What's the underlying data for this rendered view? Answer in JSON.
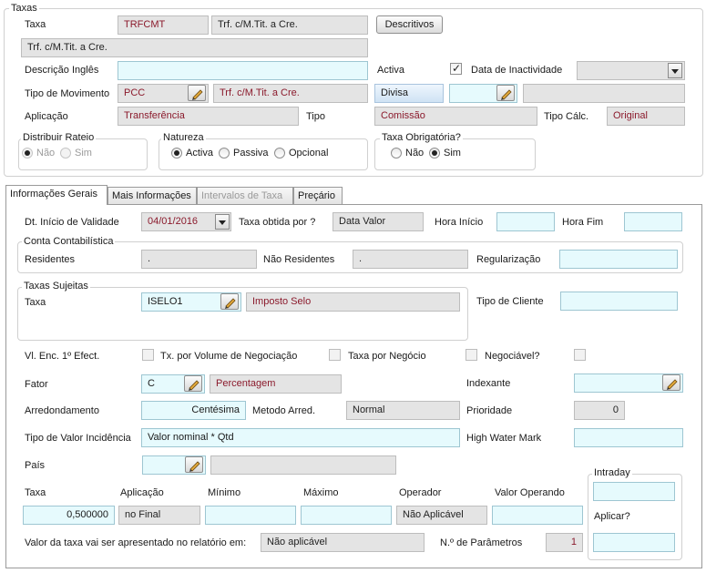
{
  "taxas": {
    "title": "Taxas",
    "taxa_label": "Taxa",
    "taxa_code": "TRFCMT",
    "taxa_desc": "Trf. c/M.Tit. a Cre.",
    "descritivos_btn": "Descritivos",
    "long_desc": "Trf. c/M.Tit. a Cre.",
    "desc_ingles_label": "Descrição Inglês",
    "desc_ingles_value": "",
    "activa_label": "Activa",
    "activa_checked": true,
    "data_inact_label": "Data de Inactividade",
    "data_inact_value": "",
    "tipo_mov_label": "Tipo de Movimento",
    "tipo_mov_code": "PCC",
    "tipo_mov_desc": "Trf. c/M.Tit. a Cre.",
    "divisa_label": "Divisa",
    "divisa_value": "",
    "divisa_desc": "",
    "aplicacao_label": "Aplicação",
    "aplicacao_value": "Transferência",
    "tipo_label": "Tipo",
    "tipo_value": "Comissão",
    "tipo_calc_label": "Tipo Cálc.",
    "tipo_calc_value": "Original",
    "distribuir_title": "Distribuir Rateio",
    "nao": "Não",
    "sim": "Sim",
    "natureza_title": "Natureza",
    "activa_opt": "Activa",
    "passiva_opt": "Passiva",
    "opcional_opt": "Opcional",
    "obrigatoria_title": "Taxa Obrigatória?"
  },
  "tabs": [
    {
      "label": "Informações Gerais",
      "active": true,
      "disabled": false
    },
    {
      "label": "Mais Informações",
      "active": false,
      "disabled": false
    },
    {
      "label": "Intervalos de Taxa",
      "active": false,
      "disabled": true
    },
    {
      "label": "Preçário",
      "active": false,
      "disabled": false
    }
  ],
  "gerais": {
    "dt_inicio_label": "Dt. Início de Validade",
    "dt_inicio_value": "04/01/2016",
    "taxa_obtida_label": "Taxa obtida por ?",
    "taxa_obtida_value": "Data Valor",
    "hora_inicio_label": "Hora Início",
    "hora_inicio_value": "",
    "hora_fim_label": "Hora Fim",
    "hora_fim_value": "",
    "conta_title": "Conta Contabilística",
    "residentes_label": "Residentes",
    "residentes_value": ".",
    "nao_residentes_label": "Não Residentes",
    "nao_residentes_value": ".",
    "regularizacao_label": "Regularização",
    "regularizacao_value": "",
    "sujeitas_title": "Taxas Sujeitas",
    "suj_taxa_label": "Taxa",
    "suj_taxa_code": "ISELO1",
    "suj_taxa_desc": "Imposto Selo",
    "tipo_cliente_label": "Tipo de Cliente",
    "tipo_cliente_value": "",
    "vl_enc_label": "Vl. Enc. 1º Efect.",
    "tx_volume_label": "Tx. por Volume de Negociação",
    "taxa_negocio_label": "Taxa por Negócio",
    "negociavel_label": "Negociável?",
    "fator_label": "Fator",
    "fator_code": "C",
    "fator_desc": "Percentagem",
    "indexante_label": "Indexante",
    "indexante_value": "",
    "arred_label": "Arredondamento",
    "arred_value": "Centésima",
    "metodo_arred_label": "Metodo Arred.",
    "metodo_arred_value": "Normal",
    "prioridade_label": "Prioridade",
    "prioridade_value": "0",
    "tipo_valor_label": "Tipo de Valor Incidência",
    "tipo_valor_value": "Valor nominal * Qtd",
    "high_water_label": "High Water Mark",
    "high_water_value": "",
    "pais_label": "País",
    "pais_value": "",
    "pais_desc": "",
    "col_taxa": "Taxa",
    "col_aplicacao": "Aplicação",
    "col_minimo": "Mínimo",
    "col_maximo": "Máximo",
    "col_operador": "Operador",
    "col_valor_operando": "Valor Operando",
    "taxa_value": "0,500000",
    "aplicacao_value": "no Final",
    "minimo_value": "",
    "maximo_value": "",
    "operador_value": "Não Aplicável",
    "valor_operando_value": "",
    "intraday_title": "Intraday",
    "intraday_value": "",
    "aplicar_label": "Aplicar?",
    "aplicar_value": "",
    "valor_relatorio_label": "Valor da taxa vai ser apresentado no relatório em:",
    "valor_relatorio_value": "Não aplicável",
    "n_param_label": "N.º de Parâmetros",
    "n_param_value": "1"
  }
}
